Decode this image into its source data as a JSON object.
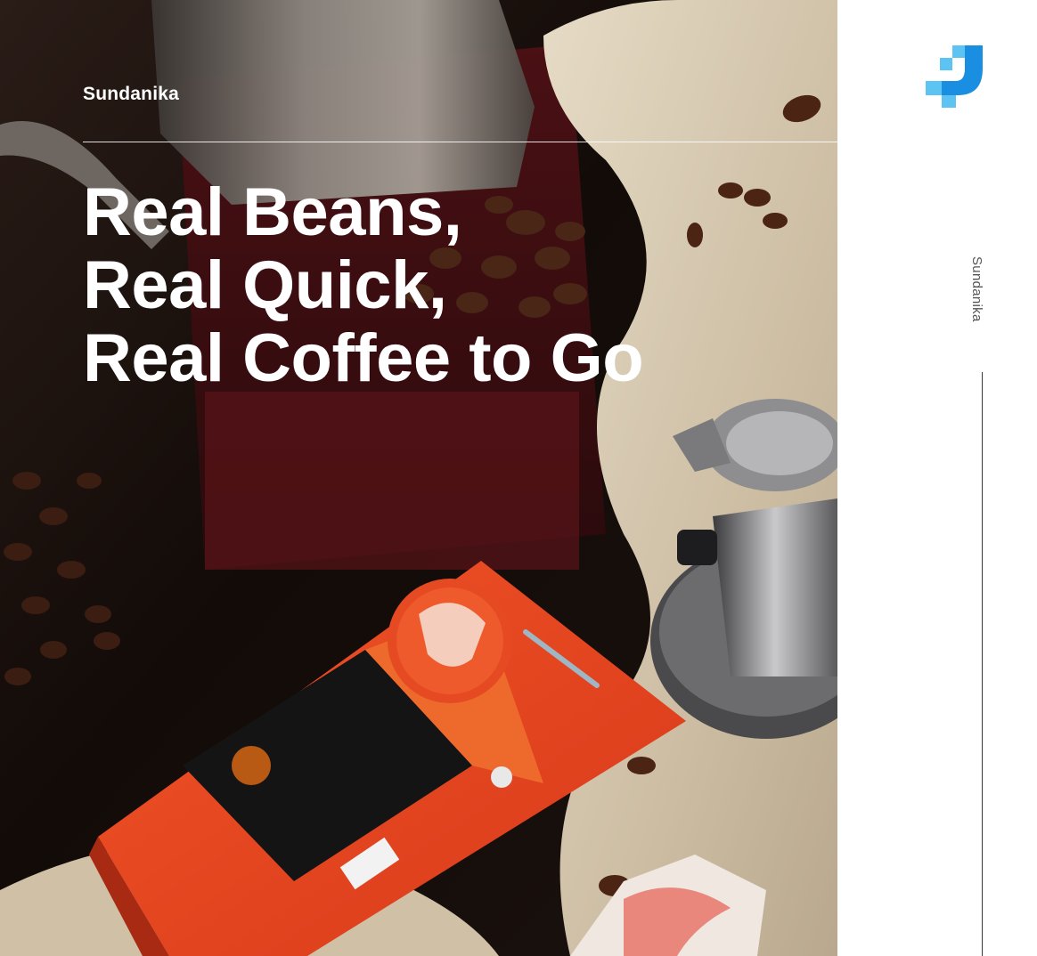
{
  "header": {
    "brand": "Sundanika"
  },
  "headline": {
    "line1": "Real Beans,",
    "line2": "Real Quick,",
    "line3": "Real Coffee to Go"
  },
  "sidebar": {
    "brand": "Sundanika",
    "logo_icon": "brand-logo-icon"
  },
  "photo": {
    "description_icon": "coffee-product-photo",
    "colors": {
      "box": "#e8431f",
      "label": "#151414",
      "cloth": "#d8cab3",
      "beans": "#4a2616",
      "dark_bg": "#140b08",
      "logo_blue": "#1a8ee0",
      "logo_light": "#5cc3f2"
    }
  }
}
